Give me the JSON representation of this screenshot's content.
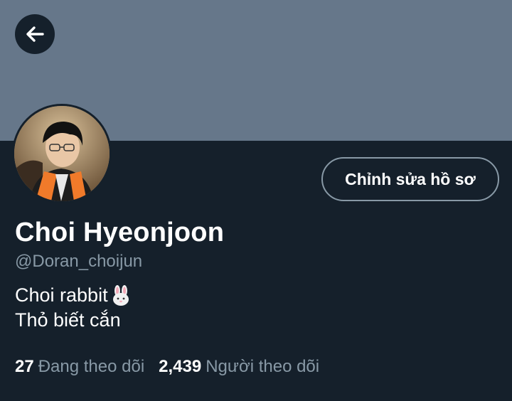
{
  "header": {
    "back_icon": "arrow-left-icon",
    "banner_color": "#66778a"
  },
  "profile": {
    "avatar_icon": "profile-photo",
    "display_name": "Choi Hyeonjoon",
    "handle": "@Doran_choijun",
    "bio_line1": "Choi rabbit",
    "bio_line1_emoji": "rabbit-face-icon",
    "bio_line2": "Thỏ biết cắn"
  },
  "actions": {
    "edit_profile_label": "Chỉnh sửa hồ sơ"
  },
  "stats": {
    "following_count": "27",
    "following_label": "Đang theo dõi",
    "followers_count": "2,439",
    "followers_label": "Người theo dõi"
  },
  "colors": {
    "background": "#15202b",
    "secondary_text": "#8899a6",
    "text": "#ffffff"
  }
}
